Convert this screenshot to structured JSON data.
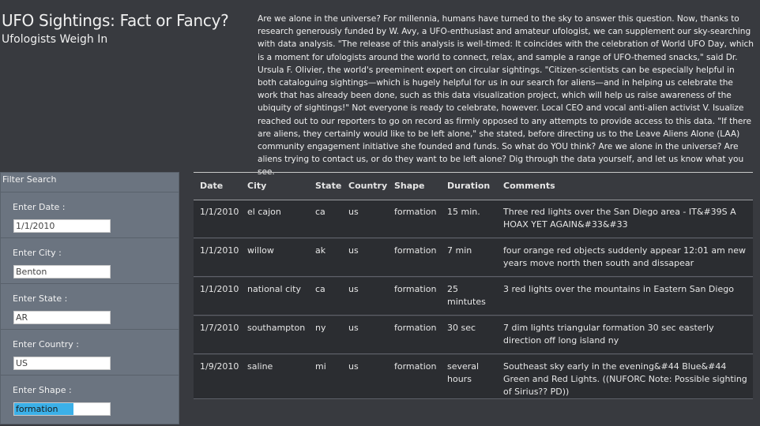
{
  "header": {
    "title": "UFO Sightings: Fact or Fancy?",
    "subtitle": "Ufologists Weigh In"
  },
  "intro": "Are we alone in the universe? For millennia, humans have turned to the sky to answer this question. Now, thanks to research generously funded by W. Avy, a UFO-enthusiast and amateur ufologist, we can supplement our sky-searching with data analysis. \"The release of this analysis is well-timed: It coincides with the celebration of World UFO Day, which is a moment for ufologists around the world to connect, relax, and sample a range of UFO-themed snacks,\" said Dr. Ursula F. Olivier, the world's preeminent expert on circular sightings. \"Citizen-scientists can be especially helpful in both cataloguing sightings—which is hugely helpful for us in our search for aliens—and in helping us celebrate the work that has already been done, such as this data visualization project, which will help us raise awareness of the ubiquity of sightings!\" Not everyone is ready to celebrate, however. Local CEO and vocal anti-alien activist V. Isualize reached out to our reporters to go on record as firmly opposed to any attempts to provide access to this data. \"If there are aliens, they certainly would like to be left alone,\" she stated, before directing us to the Leave Aliens Alone (LAA) community engagement initiative she founded and funds. So what do YOU think? Are we alone in the universe? Are aliens trying to contact us, or do they want to be left alone? Dig through the data yourself, and let us know what you see.",
  "filters": {
    "title": "Filter Search",
    "items": [
      {
        "label": "Enter Date :",
        "value": "1/1/2010"
      },
      {
        "label": "Enter City :",
        "value": "Benton"
      },
      {
        "label": "Enter State :",
        "value": "AR"
      },
      {
        "label": "Enter Country :",
        "value": "US"
      },
      {
        "label": "Enter Shape :",
        "value": "formation"
      }
    ]
  },
  "table": {
    "headers": [
      "Date",
      "City",
      "State",
      "Country",
      "Shape",
      "Duration",
      "Comments"
    ],
    "rows": [
      [
        "1/1/2010",
        "el cajon",
        "ca",
        "us",
        "formation",
        "15 min.",
        "Three red lights over the San Diego area - IT&#39S A HOAX YET AGAIN&#33&#33"
      ],
      [
        "1/1/2010",
        "willow",
        "ak",
        "us",
        "formation",
        "7 min",
        "four orange red objects suddenly appear 12:01 am new years move north then south and dissapear"
      ],
      [
        "1/1/2010",
        "national city",
        "ca",
        "us",
        "formation",
        "25 mintutes",
        "3 red lights over the mountains in Eastern San Diego"
      ],
      [
        "1/7/2010",
        "southampton",
        "ny",
        "us",
        "formation",
        "30 sec",
        "7 dim lights triangular formation 30 sec easterly direction off long island ny"
      ],
      [
        "1/9/2010",
        "saline",
        "mi",
        "us",
        "formation",
        "several hours",
        "Southeast sky early in the evening&#44 Blue&#44 Green and Red Lights. ((NUFORC Note: Possible sighting of Sirius?? PD))"
      ]
    ]
  },
  "colors": {
    "page_bg": "#383a3f",
    "panel_bg": "#6b7480",
    "row_bg": "#2b2d31",
    "selection": "#3bb0e8"
  }
}
